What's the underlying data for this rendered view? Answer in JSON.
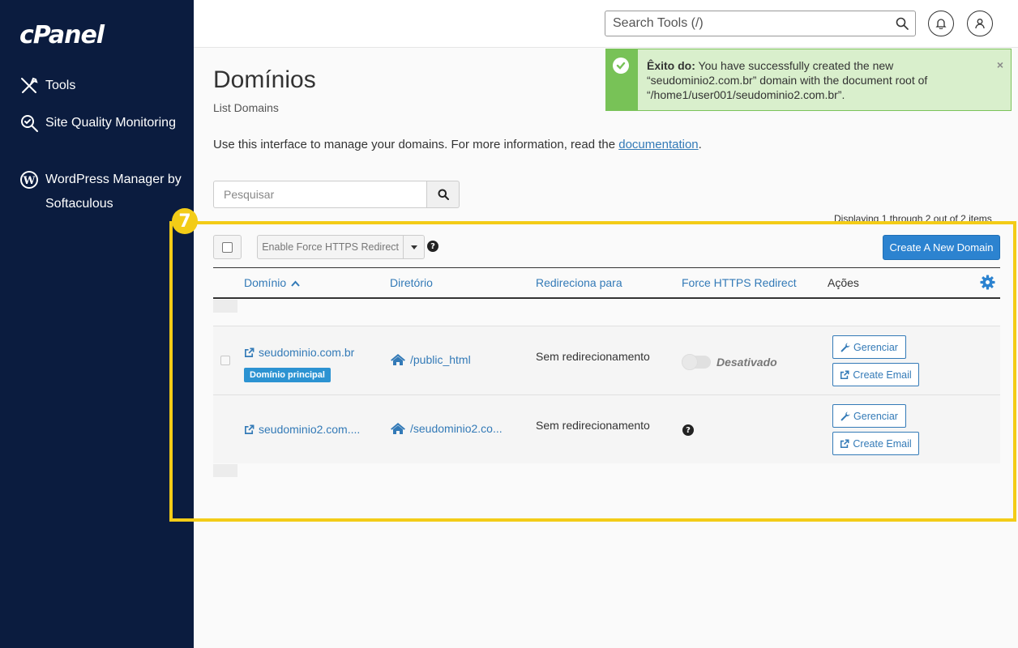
{
  "sidebar": {
    "logo": "cPanel",
    "items": [
      {
        "label": "Tools",
        "icon": "tools-icon"
      },
      {
        "label": "Site Quality Monitoring",
        "icon": "site-quality-icon"
      },
      {
        "label": "WordPress Manager by Softaculous",
        "icon": "wordpress-icon"
      }
    ]
  },
  "topbar": {
    "search_placeholder": "Search Tools (/)"
  },
  "alert": {
    "strong": "Êxito do:",
    "message": " You have successfully created the new “seudominio2.com.br” domain with the document root of “/home1/user001/seudominio2.com.br”.",
    "close": "×"
  },
  "page": {
    "title": "Domínios",
    "subtitle": "List Domains",
    "description": "Use this interface to manage your domains. For more information, read the ",
    "doc_link": "documentation",
    "desc_end": ".",
    "search_placeholder": "Pesquisar",
    "displaying": "Displaying 1 through 2 out of 2 items"
  },
  "annotation": {
    "number": "7"
  },
  "toolbar": {
    "https_redirect": "Enable Force HTTPS Redirect",
    "help": "?",
    "create": "Create A New Domain"
  },
  "table": {
    "headers": {
      "domain": "Domínio",
      "directory": "Diretório",
      "redirect": "Redireciona para",
      "https": "Force HTTPS Redirect",
      "actions": "Ações"
    },
    "rows": [
      {
        "domain": "seudominio.com.br",
        "badge": "Domínio principal",
        "directory": "/public_html",
        "redirect": "Sem redirecionamento",
        "https_status": "Desativado",
        "manage": "Gerenciar",
        "email": "Create Email"
      },
      {
        "domain": "seudominio2.com....",
        "directory": "/seudominio2.co...",
        "redirect": "Sem redirecionamento",
        "https_help": "?",
        "manage": "Gerenciar",
        "email": "Create Email"
      }
    ]
  },
  "colors": {
    "sidebar_bg": "#0b1c3f",
    "link": "#337ab7",
    "primary": "#2c83d0",
    "success_bg": "#d9efcc",
    "success_accent": "#78c257",
    "highlight": "#f3cc17"
  }
}
